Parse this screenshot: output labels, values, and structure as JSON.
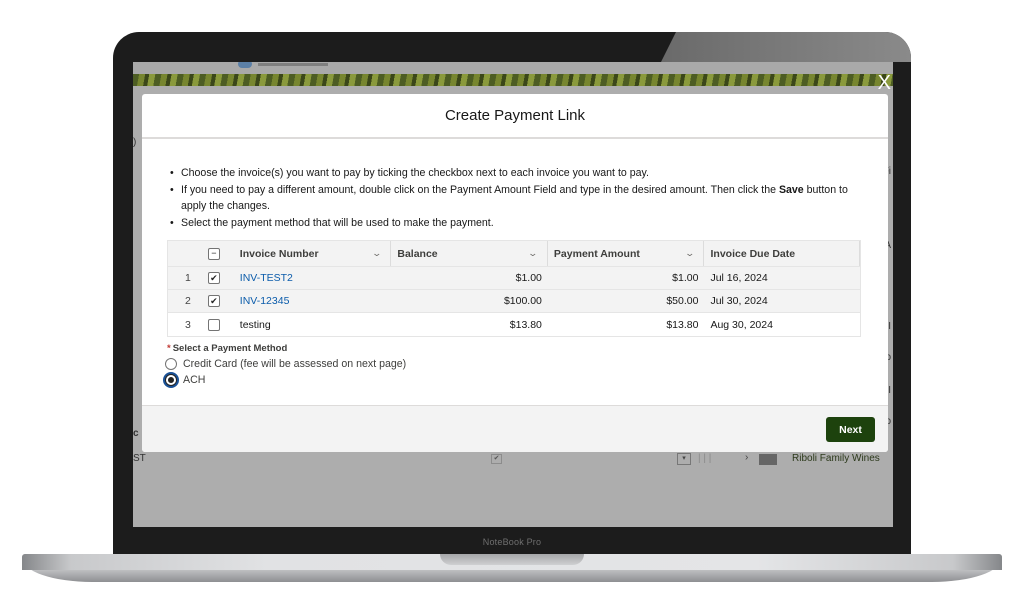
{
  "device": {
    "brand_label": "NoteBook Pro"
  },
  "background_page": {
    "left_fragments": [
      ")",
      "c",
      "ST"
    ],
    "right_fragments": [
      "Fi",
      "A",
      "s I",
      "co",
      "s I",
      "co"
    ],
    "bottom_row": {
      "account_name": "Riboli Family Wines"
    },
    "close_label": "X"
  },
  "modal": {
    "title": "Create Payment Link",
    "instructions": [
      "Choose the invoice(s) you want to pay by ticking the checkbox next to each invoice you want to pay.",
      "If you need to pay a different amount, double click on the Payment Amount Field and type in the desired amount. Then click the ",
      "Save",
      " button to apply the changes.",
      "Select the payment method that will be used to make the payment."
    ],
    "table": {
      "header_select_state": "indeterminate",
      "header_select_glyph": "−",
      "columns": [
        "Invoice Number",
        "Balance",
        "Payment Amount",
        "Invoice Due Date"
      ],
      "rows": [
        {
          "index": "1",
          "checked": true,
          "invoice_number": "INV-TEST2",
          "is_link": true,
          "balance": "$1.00",
          "payment_amount": "$1.00",
          "due_date": "Jul 16, 2024"
        },
        {
          "index": "2",
          "checked": true,
          "invoice_number": "INV-12345",
          "is_link": true,
          "balance": "$100.00",
          "payment_amount": "$50.00",
          "due_date": "Jul 30, 2024"
        },
        {
          "index": "3",
          "checked": false,
          "invoice_number": "testing",
          "is_link": false,
          "balance": "$13.80",
          "payment_amount": "$13.80",
          "due_date": "Aug 30, 2024"
        }
      ],
      "check_glyph": "✔",
      "chevron_glyph": "⌄"
    },
    "payment_method": {
      "required_marker": "*",
      "label": "Select a Payment Method",
      "options": [
        {
          "label": "Credit Card (fee will be assessed on next page)",
          "selected": false
        },
        {
          "label": "ACH",
          "selected": true
        }
      ]
    },
    "footer": {
      "next_label": "Next"
    }
  },
  "colors": {
    "primary_button": "#1d420d",
    "link": "#0b5cab",
    "required": "#c23934",
    "focus_ring": "#1b5297"
  }
}
